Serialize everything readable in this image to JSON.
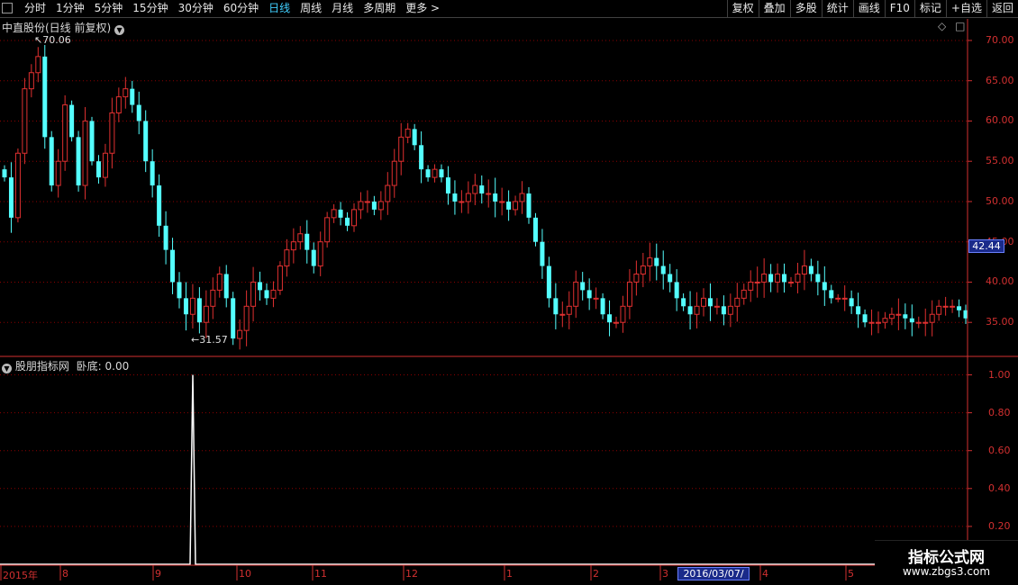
{
  "toolbar": {
    "period_tabs": [
      {
        "label": "分时"
      },
      {
        "label": "1分钟"
      },
      {
        "label": "5分钟"
      },
      {
        "label": "15分钟"
      },
      {
        "label": "30分钟"
      },
      {
        "label": "60分钟"
      },
      {
        "label": "日线",
        "active": true
      },
      {
        "label": "周线"
      },
      {
        "label": "月线"
      },
      {
        "label": "多周期"
      },
      {
        "label": "更多 >"
      }
    ],
    "right_tools": [
      "复权",
      "叠加",
      "多股",
      "统计",
      "画线",
      "F10",
      "标记",
      "+自选",
      "返回"
    ]
  },
  "main_panel": {
    "title": "中直股份(日线 前复权)",
    "high_marker": "70.06",
    "low_marker": "31.57",
    "current_price": "42.44",
    "y_ticks": [
      "70.00",
      "65.00",
      "60.00",
      "55.00",
      "50.00",
      "45.00",
      "40.00",
      "35.00"
    ]
  },
  "indicator_panel": {
    "title": "股朋指标网",
    "value_label": "卧底: 0.00",
    "y_ticks": [
      "1.00",
      "0.80",
      "0.60",
      "0.40",
      "0.20"
    ]
  },
  "date_axis": {
    "labels": [
      "2015年",
      "8",
      "9",
      "10",
      "11",
      "12",
      "1",
      "2",
      "3",
      "4",
      "5"
    ],
    "cursor_date": "2016/03/07/—"
  },
  "watermark": {
    "line1": "指标公式网",
    "line2": "www.zbgs3.com"
  },
  "colors": {
    "up": "#e03030",
    "down": "#54ffff",
    "axis": "#d23030",
    "grid": "#8b0000",
    "signal": "#ffffff"
  },
  "chart_data": [
    {
      "type": "candlestick",
      "title": "中直股份(日线 前复权)",
      "ylim": [
        31.0,
        71.0
      ],
      "x_months": [
        "2015-07",
        "2015-08",
        "2015-09",
        "2015-10",
        "2015-11",
        "2015-12",
        "2016-01",
        "2016-02",
        "2016-03",
        "2016-04",
        "2016-05"
      ],
      "high": 70.06,
      "low": 31.57,
      "last": 42.44,
      "approx_closes": [
        53.0,
        48.0,
        56.0,
        64.0,
        66.0,
        68.0,
        58.0,
        52.0,
        55.0,
        62.0,
        58.0,
        52.0,
        60.0,
        55.0,
        53.0,
        56.0,
        61.0,
        63.0,
        64.0,
        62.0,
        60.0,
        55.0,
        52.0,
        47.0,
        44.0,
        40.0,
        38.0,
        36.0,
        38.0,
        35.0,
        37.0,
        39.0,
        41.0,
        38.0,
        33.0,
        34.0,
        37.0,
        40.0,
        39.0,
        38.0,
        39.0,
        42.0,
        44.0,
        45.0,
        46.0,
        44.0,
        42.0,
        45.0,
        48.0,
        49.0,
        48.0,
        47.0,
        49.0,
        50.0,
        50.0,
        49.0,
        50.0,
        52.0,
        55.0,
        58.0,
        59.0,
        57.0,
        54.0,
        53.0,
        54.0,
        53.0,
        51.0,
        50.0,
        50.0,
        51.0,
        52.0,
        51.0,
        51.0,
        50.0,
        50.0,
        49.0,
        50.0,
        51.0,
        48.0,
        45.0,
        42.0,
        38.0,
        36.0,
        36.0,
        37.0,
        40.0,
        39.0,
        38.0,
        38.0,
        36.0,
        35.0,
        35.0,
        37.0,
        40.0,
        41.0,
        42.0,
        43.0,
        42.0,
        41.0,
        40.0,
        38.0,
        37.0,
        36.0,
        37.0,
        38.0,
        37.0,
        37.0,
        36.0,
        37.0,
        38.0,
        39.0,
        40.0,
        40.0,
        41.0,
        40.0,
        41.0,
        40.0,
        40.0,
        41.0,
        42.0,
        41.0,
        40.0,
        39.0,
        38.0,
        38.0,
        38.0,
        37.0,
        36.0,
        35.0,
        35.0,
        35.0,
        35.5,
        36.0,
        36.0,
        35.5,
        35.0,
        35.0,
        35.0,
        36.0,
        37.0,
        37.0,
        37.0,
        36.5,
        35.5
      ]
    },
    {
      "type": "line",
      "title": "股朋指标网",
      "series": [
        {
          "name": "卧底",
          "current": 0.0,
          "spike_value": 1.0,
          "spike_month": "2015-09"
        }
      ],
      "ylim": [
        0.0,
        1.05
      ]
    }
  ]
}
